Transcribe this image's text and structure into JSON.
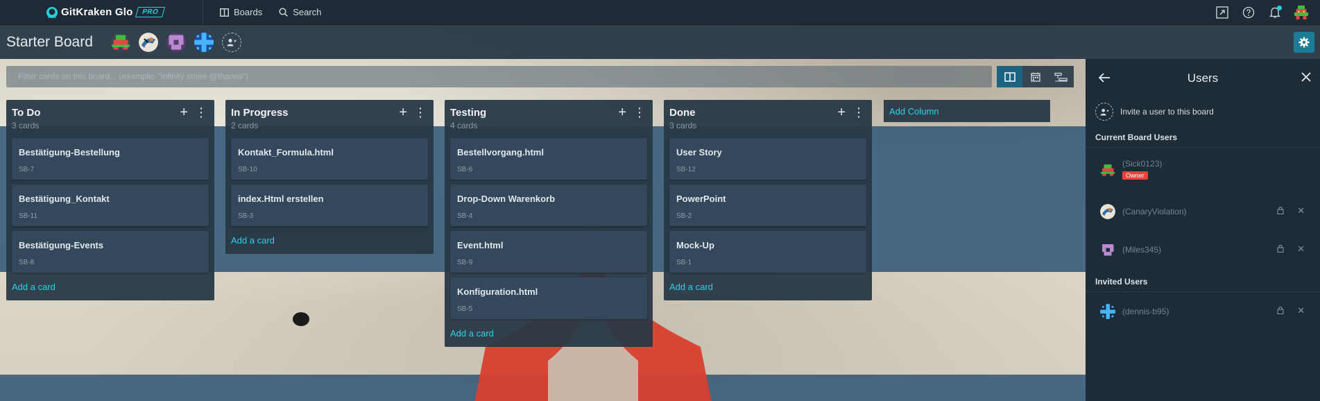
{
  "app": {
    "brand": "GitKraken Glo",
    "plan_badge": "PRO"
  },
  "nav": {
    "boards_label": "Boards",
    "search_label": "Search"
  },
  "board": {
    "title": "Starter Board",
    "filter_placeholder": "Filter cards on this board... (example: \"infinity stone @thanos\")"
  },
  "columns": [
    {
      "title": "To Do",
      "count": "3 cards",
      "add_card": "Add a card",
      "cards": [
        {
          "title": "Bestätigung-Bestellung",
          "id": "SB-7"
        },
        {
          "title": "Bestätigung_Kontakt",
          "id": "SB-11"
        },
        {
          "title": "Bestätigung-Events",
          "id": "SB-8"
        }
      ]
    },
    {
      "title": "In Progress",
      "count": "2 cards",
      "add_card": "Add a card",
      "cards": [
        {
          "title": "Kontakt_Formula.html",
          "id": "SB-10"
        },
        {
          "title": "index.Html erstellen",
          "id": "SB-3"
        }
      ]
    },
    {
      "title": "Testing",
      "count": "4 cards",
      "add_card": "Add a card",
      "cards": [
        {
          "title": "Bestellvorgang.html",
          "id": "SB-6"
        },
        {
          "title": "Drop-Down Warenkorb",
          "id": "SB-4"
        },
        {
          "title": "Event.html",
          "id": "SB-9"
        },
        {
          "title": "Konfiguration.html",
          "id": "SB-5"
        }
      ]
    },
    {
      "title": "Done",
      "count": "3 cards",
      "add_card": "Add a card",
      "cards": [
        {
          "title": "User Story",
          "id": "SB-12"
        },
        {
          "title": "PowerPoint",
          "id": "SB-2"
        },
        {
          "title": "Mock-Up",
          "id": "SB-1"
        }
      ]
    }
  ],
  "add_column_label": "Add Column",
  "users_panel": {
    "title": "Users",
    "invite_label": "Invite a user to this board",
    "current_heading": "Current Board Users",
    "invited_heading": "Invited Users",
    "owner_badge": "Owner",
    "current_users": [
      {
        "name": "(Sick0123)",
        "owner": true
      },
      {
        "name": "(CanaryViolation)",
        "owner": false
      },
      {
        "name": "(Miles345)",
        "owner": false
      }
    ],
    "invited_users": [
      {
        "name": "(dennis-b95)"
      }
    ]
  },
  "colors": {
    "accent": "#2bd3e6",
    "topbar": "#1e2b36",
    "column_bg": "#27374a",
    "owner_badge": "#e8443a",
    "settings_button": "#1c7c95"
  },
  "icons": {
    "nav_right": [
      "external-link-icon",
      "help-icon",
      "bell-icon",
      "user-avatar"
    ],
    "view_modes": [
      "board-view-icon",
      "calendar-view-icon",
      "timeline-view-icon"
    ]
  }
}
